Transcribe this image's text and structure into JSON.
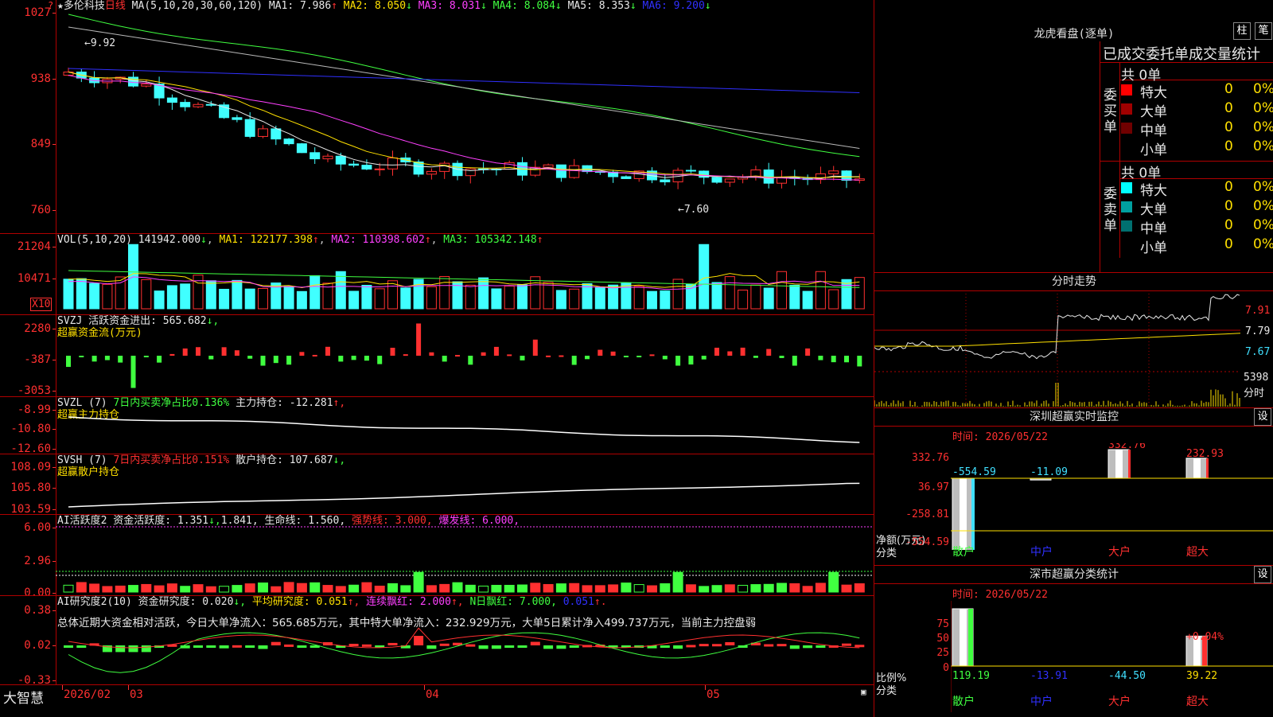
{
  "main": {
    "code_header": "★多伦科技",
    "period": "日线",
    "ma_label": "MA(5,10,20,30,60,120)",
    "ma": [
      {
        "label": "MA1:",
        "value": "7.986",
        "arrow": "↑",
        "color": "#e8e8e8"
      },
      {
        "label": "MA2:",
        "value": "8.050",
        "arrow": "↓",
        "color": "#ffe000"
      },
      {
        "label": "MA3:",
        "value": "8.031",
        "arrow": "↓",
        "color": "#ff40ff"
      },
      {
        "label": "MA4:",
        "value": "8.084",
        "arrow": "↓",
        "color": "#40ff40"
      },
      {
        "label": "MA5:",
        "value": "8.353",
        "arrow": "↓",
        "color": "#e8e8e8"
      },
      {
        "label": "MA6:",
        "value": "9.200",
        "arrow": "↓",
        "color": "#3030ff"
      }
    ],
    "ticks": [
      "1027",
      "938",
      "849",
      "760"
    ],
    "hi_label": "←9.92",
    "lo_label": "←7.60",
    "tl_marker": "?"
  },
  "vol": {
    "title": "VOL(5,10,20)",
    "value": "141942.000",
    "value_arrow": "↓",
    "ma1": "MA1: 122177.398",
    "ma1_arrow": "↑",
    "ma2": "MA2: 110398.602",
    "ma2_arrow": "↑",
    "ma3": "MA3: 105342.148",
    "ma3_arrow": "↑",
    "ticks": [
      "21204",
      "10471"
    ],
    "unit": "X10"
  },
  "svzj": {
    "title": "SVZJ  活跃资金进出: 565.682",
    "arrow": "↓,",
    "sub": "超赢资金流(万元)",
    "ticks": [
      "2280",
      "-387",
      "-3053"
    ]
  },
  "svzl": {
    "title": "SVZL (7)",
    "p1": "7日内买卖净占比0.136%",
    "p2": "主力持仓: -12.281",
    "arrow": "↑,",
    "sub": "超赢主力持仓",
    "ticks": [
      "-8.99",
      "-10.80",
      "-12.60"
    ]
  },
  "svsh": {
    "title": "SVSH (7)",
    "p1": "7日内买卖净占比0.151%",
    "p2": "散户持仓: 107.687",
    "arrow": "↓,",
    "sub": "超赢散户持仓",
    "ticks": [
      "108.09",
      "105.80",
      "103.59"
    ]
  },
  "ai1": {
    "title": "AI活跃度2 资金活跃度: 1.351",
    "a1": "↓,",
    "v2": "1.841,",
    "v3": "生命线: 1.560,",
    "v4": "强势线: 3.000,",
    "v5": "爆发线: 6.000,",
    "ticks": [
      "6.00",
      "2.96",
      "0.00"
    ]
  },
  "ai2": {
    "title": "AI研究度2(10) 资金研究度: 0.020",
    "a1": "↓,",
    "v2": "平均研究度: 0.051",
    "a2": "↑,",
    "v3": "连续飘红: 2.000",
    "a3": "↑,",
    "v4": "N日飘红: 7.000,",
    "v5": "0.051",
    "a5": "↑.",
    "summary": "总体近期大资金相对活跃，今日大单净流入：565.685万元，其中特大单净流入：232.929万元，大单5日累计净入499.737万元，当前主力控盘弱",
    "ticks": [
      "0.38",
      "0.02",
      "-0.33"
    ]
  },
  "dates": {
    "brand": "大智慧",
    "d1": "2026/02",
    "d2": "03",
    "d3": "04",
    "d4": "05"
  },
  "dragon": {
    "title": "龙虎看盘(逐单)",
    "btn1": "柱",
    "btn2": "笔",
    "subtitle": "已成交委托单成交量统计",
    "buy": {
      "total": "共 0单",
      "side": "委买单",
      "rows": [
        {
          "name": "特大",
          "qty": "0",
          "pct": "0%",
          "color": "#ff0000"
        },
        {
          "name": "大单",
          "qty": "0",
          "pct": "0%",
          "color": "#a00000"
        },
        {
          "name": "中单",
          "qty": "0",
          "pct": "0%",
          "color": "#700000"
        },
        {
          "name": "小单",
          "qty": "0",
          "pct": "0%",
          "color": ""
        }
      ]
    },
    "sell": {
      "total": "共 0单",
      "side": "委卖单",
      "rows": [
        {
          "name": "特大",
          "qty": "0",
          "pct": "0%",
          "color": "#00ffff"
        },
        {
          "name": "大单",
          "qty": "0",
          "pct": "0%",
          "color": "#00a0a0"
        },
        {
          "name": "中单",
          "qty": "0",
          "pct": "0%",
          "color": "#007070"
        },
        {
          "name": "小单",
          "qty": "0",
          "pct": "0%",
          "color": ""
        }
      ]
    }
  },
  "intraday": {
    "title": "分时走势",
    "ticks": [
      "7.91",
      "7.79",
      "7.67"
    ],
    "vol_tick": "5398",
    "vol_label": "分时"
  },
  "monitor": {
    "title": "深圳超赢实时监控",
    "btn": "设",
    "time": "时间: 2026/05/22",
    "ticks": [
      "332.76",
      "36.97",
      "-258.81",
      "-554.59"
    ],
    "bar_values": [
      "-554.59",
      "-11.09",
      "332.76",
      "232.93"
    ],
    "categories": [
      "散户",
      "中户",
      "大户",
      "超大"
    ],
    "ylabel": "净额(万元)",
    "xlabel": "分类"
  },
  "classify": {
    "title": "深市超赢分类统计",
    "btn": "设",
    "time": "时间: 2026/05/22",
    "ticks": [
      "75",
      "50",
      "25",
      "0"
    ],
    "bar_values": [
      "119.19",
      "-13.91",
      "-44.50",
      "39.22"
    ],
    "extra_label": "+0.04%",
    "categories": [
      "散户",
      "中户",
      "大户",
      "超大"
    ],
    "ylabel": "比例%",
    "xlabel": "分类"
  },
  "chart_data": [
    {
      "type": "bar",
      "title": "深圳超赢实时监控",
      "categories": [
        "散户",
        "中户",
        "大户",
        "超大"
      ],
      "values": [
        -554.59,
        -11.09,
        332.76,
        232.93
      ],
      "ylabel": "净额(万元)",
      "xlabel": "分类",
      "ylim": [
        -554.59,
        332.76
      ]
    },
    {
      "type": "bar",
      "title": "深市超赢分类统计",
      "categories": [
        "散户",
        "中户",
        "大户",
        "超大"
      ],
      "values": [
        119.19,
        -13.91,
        -44.5,
        39.22
      ],
      "ylabel": "比例%",
      "xlabel": "分类",
      "ylim": [
        0,
        75
      ]
    }
  ]
}
